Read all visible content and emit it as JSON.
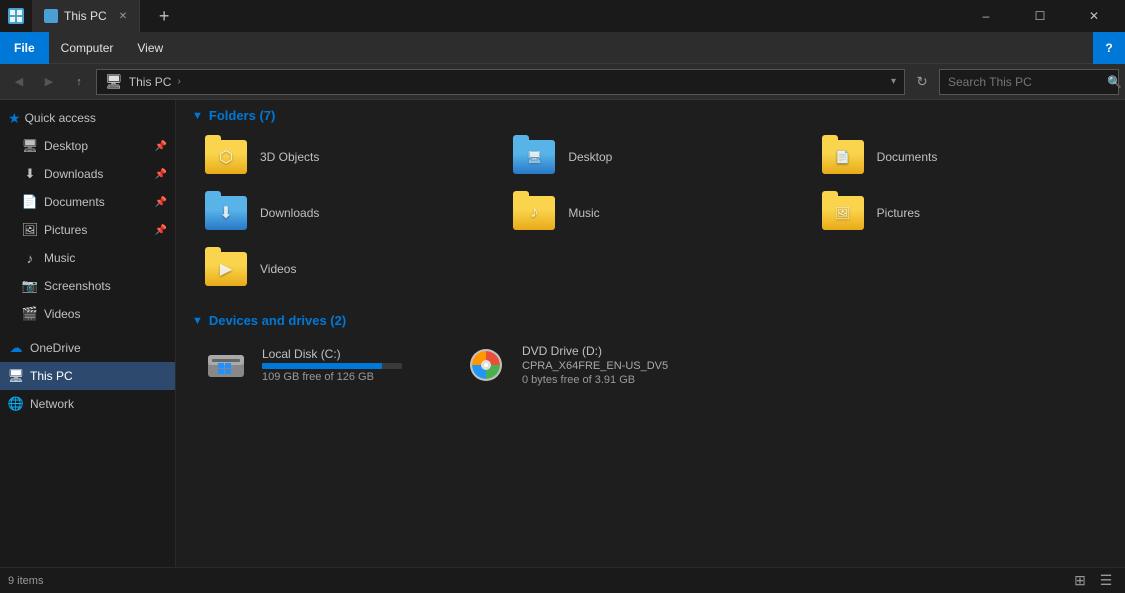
{
  "titlebar": {
    "title": "This PC",
    "icon": "pc-icon",
    "min_label": "–",
    "max_label": "☐",
    "close_label": "✕"
  },
  "menubar": {
    "file_label": "File",
    "computer_label": "Computer",
    "view_label": "View",
    "help_label": "?"
  },
  "addressbar": {
    "back_label": "‹",
    "forward_label": "›",
    "up_label": "↑",
    "path_icon": "📁",
    "path_root": "This PC",
    "arrow": "›",
    "refresh_label": "↻",
    "search_placeholder": "Search This PC"
  },
  "sidebar": {
    "quick_access_label": "Quick access",
    "items": [
      {
        "id": "desktop",
        "label": "Desktop",
        "icon": "🖥",
        "pinned": true
      },
      {
        "id": "downloads",
        "label": "Downloads",
        "icon": "⬇",
        "pinned": true
      },
      {
        "id": "documents",
        "label": "Documents",
        "icon": "📄",
        "pinned": true
      },
      {
        "id": "pictures",
        "label": "Pictures",
        "icon": "🖼",
        "pinned": true
      },
      {
        "id": "music",
        "label": "Music",
        "icon": "♪",
        "pinned": false
      },
      {
        "id": "screenshots",
        "label": "Screenshots",
        "icon": "📷",
        "pinned": false
      },
      {
        "id": "videos",
        "label": "Videos",
        "icon": "🎬",
        "pinned": false
      }
    ],
    "onedrive_label": "OneDrive",
    "thispc_label": "This PC",
    "network_label": "Network"
  },
  "content": {
    "folders_header": "Folders (7)",
    "folders": [
      {
        "id": "3dobjects",
        "label": "3D Objects",
        "type": "yellow",
        "emblem": "⬡"
      },
      {
        "id": "desktop",
        "label": "Desktop",
        "type": "blue",
        "emblem": "🖥"
      },
      {
        "id": "documents",
        "label": "Documents",
        "type": "yellow",
        "emblem": "📄"
      },
      {
        "id": "downloads",
        "label": "Downloads",
        "type": "blue",
        "emblem": "⬇"
      },
      {
        "id": "music",
        "label": "Music",
        "type": "yellow",
        "emblem": "♪"
      },
      {
        "id": "pictures",
        "label": "Pictures",
        "type": "yellow",
        "emblem": "🖼"
      },
      {
        "id": "videos",
        "label": "Videos",
        "type": "yellow",
        "emblem": "▶"
      }
    ],
    "devices_header": "Devices and drives (2)",
    "devices": [
      {
        "id": "local-disk",
        "label": "Local Disk (C:)",
        "icon": "💾",
        "bar_percent": 86,
        "bar_color": "#0078d7",
        "space": "109 GB free of 126 GB"
      },
      {
        "id": "dvd-drive",
        "label": "DVD Drive (D:)",
        "sublabel": "CPRA_X64FRE_EN-US_DV5",
        "icon": "💿",
        "bar_percent": 0,
        "bar_color": "#0078d7",
        "space": "0 bytes free of 3.91 GB"
      }
    ]
  },
  "statusbar": {
    "items_label": "9 items"
  }
}
